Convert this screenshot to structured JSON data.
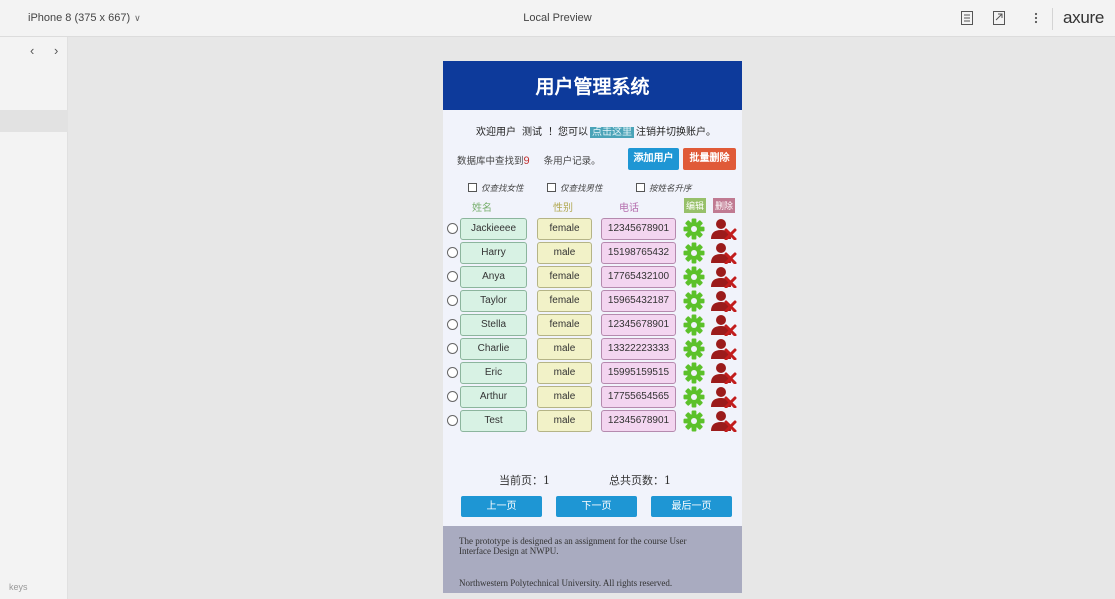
{
  "axure": {
    "device_label": "iPhone 8 (375 x 667)",
    "preview_title": "Local Preview",
    "brand": "axure",
    "nav_arrows": "‹ ›",
    "keys_label": "keys"
  },
  "app": {
    "title": "用户管理系统",
    "welcome": {
      "prefix": "欢迎用户",
      "username": "测试",
      "middle": "！您可以",
      "link": "点击这里",
      "suffix": "注销并切换账户。"
    },
    "db": {
      "prefix": "数据库中查找到",
      "count": "9",
      "suffix": "条用户记录。"
    },
    "buttons": {
      "add": "添加用户",
      "batch_delete": "批量删除"
    },
    "filters": [
      "仅查找女性",
      "仅查找男性",
      "按姓名升序"
    ],
    "columns": {
      "name": "姓名",
      "gender": "性别",
      "phone": "电话",
      "edit": "编辑",
      "delete": "删除"
    },
    "users": [
      {
        "name": "Jackieeee",
        "gender": "female",
        "phone": "12345678901"
      },
      {
        "name": "Harry",
        "gender": "male",
        "phone": "15198765432"
      },
      {
        "name": "Anya",
        "gender": "female",
        "phone": "17765432100"
      },
      {
        "name": "Taylor",
        "gender": "female",
        "phone": "15965432187"
      },
      {
        "name": "Stella",
        "gender": "female",
        "phone": "12345678901"
      },
      {
        "name": "Charlie",
        "gender": "male",
        "phone": "13322223333"
      },
      {
        "name": "Eric",
        "gender": "male",
        "phone": "15995159515"
      },
      {
        "name": "Arthur",
        "gender": "male",
        "phone": "17755654565"
      },
      {
        "name": "Test",
        "gender": "male",
        "phone": "12345678901"
      }
    ],
    "pagination": {
      "current_label": "当前页：",
      "current": "1",
      "total_label": "总共页数：",
      "total": "1",
      "prev": "上一页",
      "next": "下一页",
      "last": "最后一页"
    },
    "footer": {
      "line1": "The prototype is designed as an assignment for the course User Interface Design at NWPU.",
      "line2": "Northwestern Polytechnical University. All rights reserved."
    },
    "colors": {
      "header": "#0d3a9b",
      "primary_button": "#1e96d4",
      "danger_button": "#e05a38",
      "edit_icon": "#5cc12a",
      "delete_icon": "#9b1b1b"
    }
  }
}
